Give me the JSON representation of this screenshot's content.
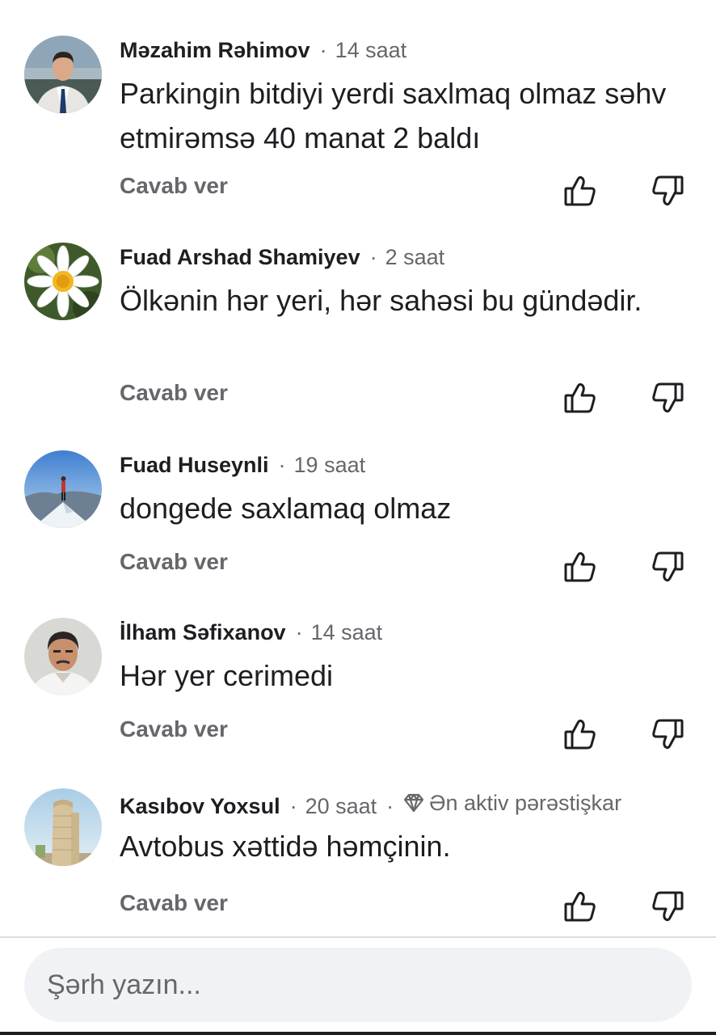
{
  "comments": [
    {
      "author": "Məzahim Rəhimov",
      "time": "14 saat",
      "text": "Parkingin bitdiyi yerdi saxlmaq olmaz səhv etmirəmsə 40 manat 2 baldı",
      "reply_label": "Cavab ver",
      "avatar": "man-in-suit-photo"
    },
    {
      "author": "Fuad Arshad Shamiyev",
      "time": "2 saat",
      "text": "Ölkənin hər yeri, hər sahəsi bu gündədir.",
      "reply_label": "Cavab ver",
      "avatar": "daisy-flower-photo"
    },
    {
      "author": "Fuad Huseynli",
      "time": "19 saat",
      "text": "dongede saxlamaq olmaz",
      "reply_label": "Cavab ver",
      "avatar": "mountain-summit-photo"
    },
    {
      "author": "İlham Səfixanov",
      "time": "14 saat",
      "text": "Hər yer cerimedi",
      "reply_label": "Cavab ver",
      "avatar": "man-portrait-photo"
    },
    {
      "author": "Kasıbov Yoxsul",
      "time": "20 saat",
      "badge": "Ən aktiv pərəstişkar",
      "badge_icon": "diamond-icon",
      "text": "Avtobus xəttidə həmçinin.",
      "reply_label": "Cavab ver",
      "avatar": "maiden-tower-photo"
    }
  ],
  "composer": {
    "placeholder": "Şərh yazın..."
  },
  "icons": {
    "like": "thumbs-up-icon",
    "dislike": "thumbs-down-icon"
  },
  "colors": {
    "text": "#1c1e21",
    "secondary": "#65676b",
    "input_bg": "#f0f2f5"
  }
}
